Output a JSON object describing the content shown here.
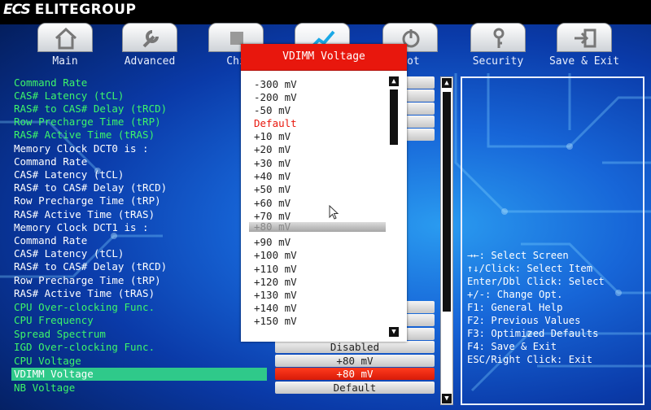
{
  "brand": {
    "badge": "ECS",
    "name": "ELITEGROUP"
  },
  "tabs": [
    {
      "label": "Main",
      "icon": "home-icon"
    },
    {
      "label": "Advanced",
      "icon": "wrench-icon"
    },
    {
      "label": "Chi",
      "icon": "chipset-icon"
    },
    {
      "label": "",
      "icon": "chart-icon"
    },
    {
      "label": "oot",
      "icon": "power-icon"
    },
    {
      "label": "Security",
      "icon": "key-icon"
    },
    {
      "label": "Save & Exit",
      "icon": "exit-icon"
    }
  ],
  "settings": [
    {
      "label": "Command Rate",
      "color": "green",
      "value": ""
    },
    {
      "label": "CAS# Latency (tCL)",
      "color": "green",
      "value": ""
    },
    {
      "label": "RAS# to CAS# Delay (tRCD)",
      "color": "green",
      "value": ""
    },
    {
      "label": "Row Precharge Time (tRP)",
      "color": "green",
      "value": ""
    },
    {
      "label": "RAS# Active Time (tRAS)",
      "color": "green",
      "value": ""
    },
    {
      "label": "Memory Clock DCT0 is :",
      "color": "white",
      "value": ""
    },
    {
      "label": "Command Rate",
      "color": "white",
      "value": ""
    },
    {
      "label": "CAS# Latency (tCL)",
      "color": "white",
      "value": ""
    },
    {
      "label": "RAS# to CAS# Delay (tRCD)",
      "color": "white",
      "value": ""
    },
    {
      "label": "Row Precharge Time (tRP)",
      "color": "white",
      "value": ""
    },
    {
      "label": "RAS# Active Time (tRAS)",
      "color": "white",
      "value": ""
    },
    {
      "label": "Memory Clock DCT1 is :",
      "color": "white",
      "value": ""
    },
    {
      "label": "Command Rate",
      "color": "white",
      "value": ""
    },
    {
      "label": "CAS# Latency (tCL)",
      "color": "white",
      "value": ""
    },
    {
      "label": "RAS# to CAS# Delay (tRCD)",
      "color": "white",
      "value": ""
    },
    {
      "label": "Row Precharge Time (tRP)",
      "color": "white",
      "value": ""
    },
    {
      "label": "RAS# Active Time (tRAS)",
      "color": "white",
      "value": ""
    },
    {
      "label": "CPU Over-clocking Func.",
      "color": "green",
      "value": ""
    },
    {
      "label": "CPU Frequency",
      "color": "green",
      "value": ""
    },
    {
      "label": "Spread Spectrum",
      "color": "green",
      "value": ""
    },
    {
      "label": "IGD Over-clocking Func.",
      "color": "green",
      "value": "Disabled"
    },
    {
      "label": "CPU Voltage",
      "color": "green",
      "value": "+80 mV"
    },
    {
      "label": "VDIMM Voltage",
      "color": "green",
      "value": "+80 mV",
      "selected": true
    },
    {
      "label": "NB Voltage",
      "color": "green",
      "value": "Default"
    }
  ],
  "popup": {
    "title": "VDIMM Voltage",
    "options": [
      "-300 mV",
      "-200 mV",
      "-50 mV",
      "Default",
      "+10 mV",
      "+20 mV",
      "+30 mV",
      "+40 mV",
      "+50 mV",
      "+60 mV",
      "+70 mV",
      "+80 mV",
      "+90 mV",
      "+100 mV",
      "+110 mV",
      "+120 mV",
      "+130 mV",
      "+140 mV",
      "+150 mV"
    ],
    "default_index": 3,
    "highlighted_index": 11
  },
  "help": [
    {
      "key": "→←:",
      "text": " Select Screen"
    },
    {
      "key": "↑↓/Click:",
      "text": " Select Item"
    },
    {
      "key": "Enter/Dbl Click:",
      "text": " Select"
    },
    {
      "key": "+/-:",
      "text": " Change Opt."
    },
    {
      "key": "F1:",
      "text": " General Help"
    },
    {
      "key": "F2:",
      "text": " Previous Values"
    },
    {
      "key": "F3:",
      "text": " Optimized Defaults"
    },
    {
      "key": "F4:",
      "text": " Save & Exit"
    },
    {
      "key": "ESC/Right Click:",
      "text": " Exit"
    }
  ],
  "colors": {
    "accent_red": "#e8170d",
    "green_text": "#3df56a",
    "selected_row": "#2fc98a"
  }
}
